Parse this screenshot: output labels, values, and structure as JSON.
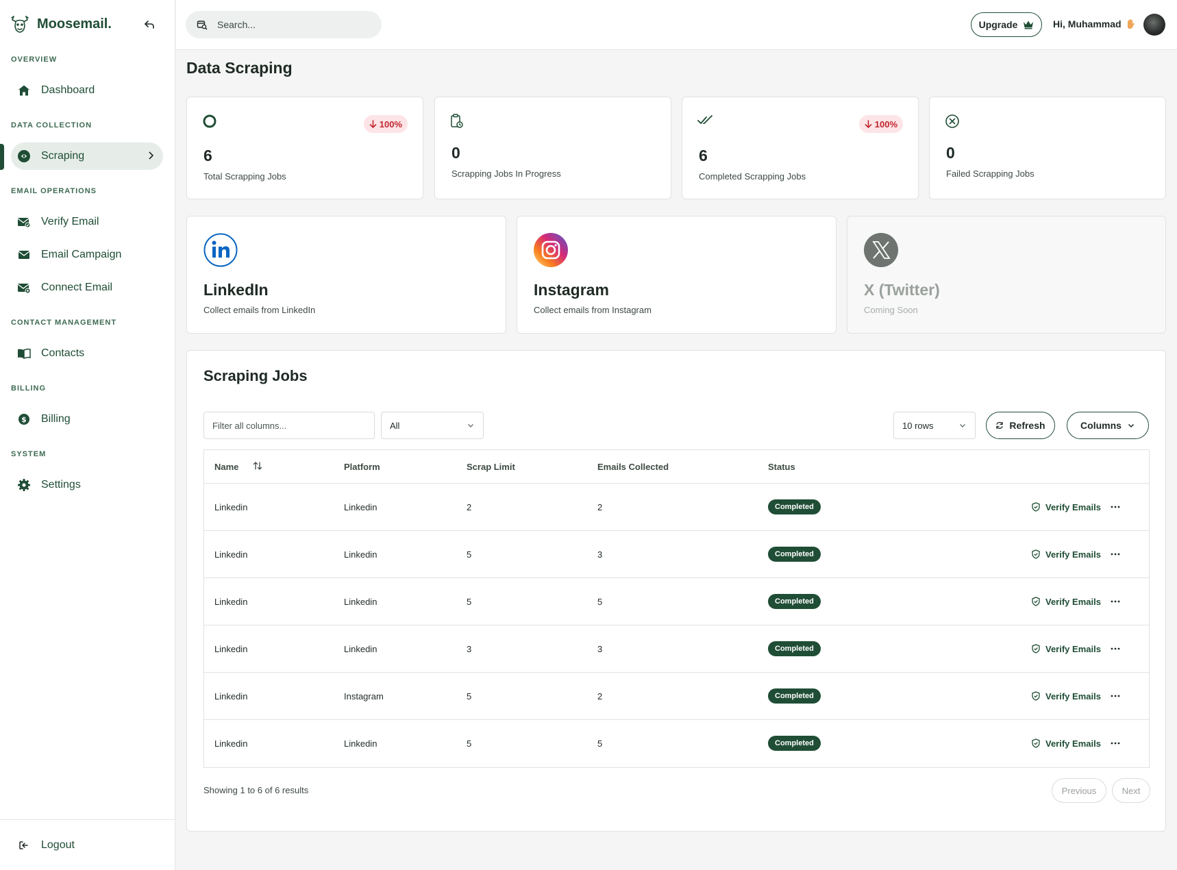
{
  "brand": {
    "name": "Moosemail."
  },
  "sidebar": {
    "sections": [
      "OVERVIEW",
      "DATA COLLECTION",
      "EMAIL OPERATIONS",
      "CONTACT MANAGEMENT",
      "BILLING",
      "SYSTEM"
    ],
    "items": [
      {
        "label": "Dashboard",
        "icon": "home-icon"
      },
      {
        "label": "Scraping",
        "icon": "scraping-icon",
        "active": true
      },
      {
        "label": "Verify Email",
        "icon": "verify-mail-icon"
      },
      {
        "label": "Email Campaign",
        "icon": "mail-icon"
      },
      {
        "label": "Connect Email",
        "icon": "connect-mail-icon"
      },
      {
        "label": "Contacts",
        "icon": "book-icon"
      },
      {
        "label": "Billing",
        "icon": "dollar-icon"
      },
      {
        "label": "Settings",
        "icon": "gear-icon"
      }
    ],
    "logout": "Logout"
  },
  "header": {
    "search_placeholder": "Search...",
    "upgrade_label": "Upgrade",
    "greeting": "Hi, Muhammad"
  },
  "page": {
    "title": "Data Scraping"
  },
  "stats": [
    {
      "value": "6",
      "label": "Total Scrapping Jobs",
      "badge": "100%"
    },
    {
      "value": "0",
      "label": "Scrapping Jobs In Progress"
    },
    {
      "value": "6",
      "label": "Completed Scrapping Jobs",
      "badge": "100%"
    },
    {
      "value": "0",
      "label": "Failed Scrapping Jobs"
    }
  ],
  "platforms": [
    {
      "name": "LinkedIn",
      "desc": "Collect emails from LinkedIn"
    },
    {
      "name": "Instagram",
      "desc": "Collect emails from Instagram"
    },
    {
      "name": "X (Twitter)",
      "desc": "Coming Soon"
    }
  ],
  "jobs": {
    "title": "Scraping Jobs",
    "filter_placeholder": "Filter all columns...",
    "status_filter": "All",
    "rows_select": "10 rows",
    "refresh_label": "Refresh",
    "columns_label": "Columns",
    "headers": [
      "Name",
      "Platform",
      "Scrap Limit",
      "Emails Collected",
      "Status"
    ],
    "rows": [
      {
        "name": "Linkedin",
        "platform": "Linkedin",
        "limit": "2",
        "collected": "2",
        "status": "Completed"
      },
      {
        "name": "Linkedin",
        "platform": "Linkedin",
        "limit": "5",
        "collected": "3",
        "status": "Completed"
      },
      {
        "name": "Linkedin",
        "platform": "Linkedin",
        "limit": "5",
        "collected": "5",
        "status": "Completed"
      },
      {
        "name": "Linkedin",
        "platform": "Linkedin",
        "limit": "3",
        "collected": "3",
        "status": "Completed"
      },
      {
        "name": "Linkedin",
        "platform": "Instagram",
        "limit": "5",
        "collected": "2",
        "status": "Completed"
      },
      {
        "name": "Linkedin",
        "platform": "Linkedin",
        "limit": "5",
        "collected": "5",
        "status": "Completed"
      }
    ],
    "verify_label": "Verify Emails",
    "showing": "Showing 1 to 6 of 6 results",
    "prev_label": "Previous",
    "next_label": "Next"
  },
  "colors": {
    "brand": "#1f4d35",
    "badge_bg": "#fde4e6",
    "badge_text": "#c0262f"
  }
}
